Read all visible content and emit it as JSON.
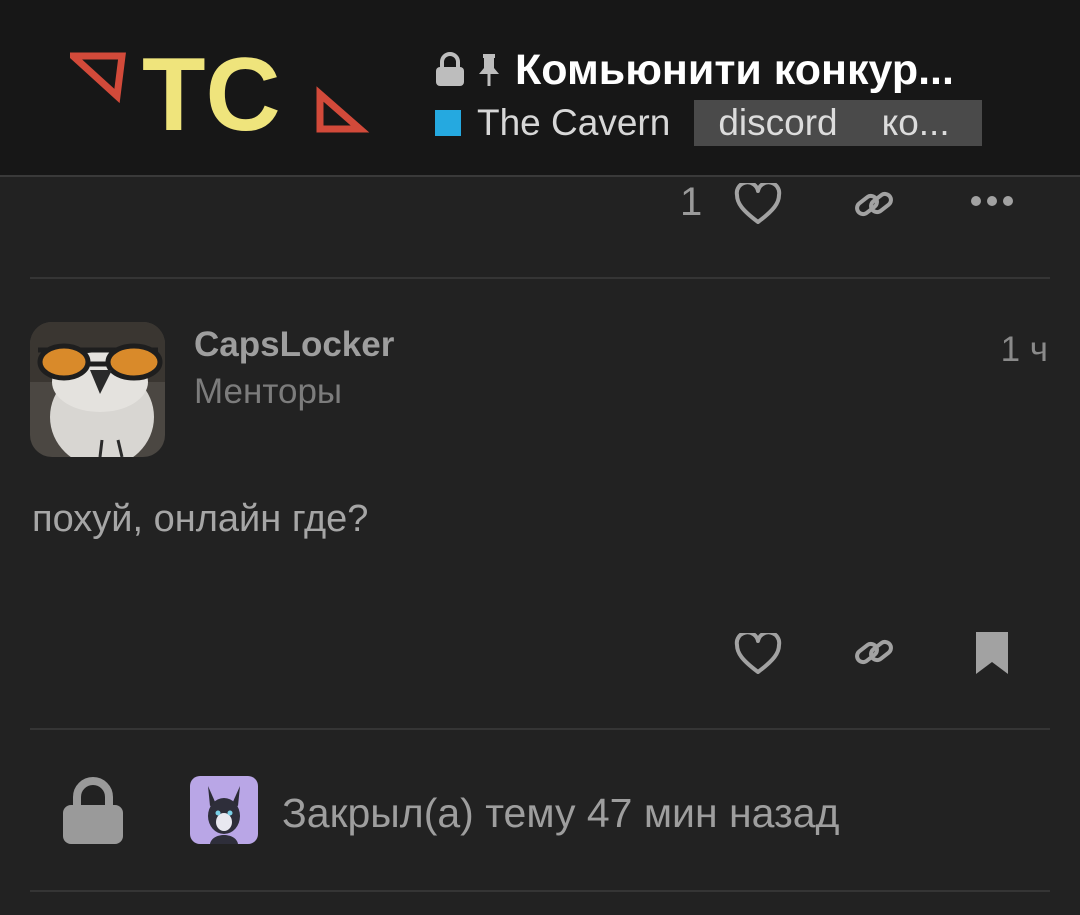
{
  "header": {
    "logo_text": "TC",
    "topic_title": "Комьюнити конкур...",
    "category": "The Cavern",
    "tags": [
      "discord",
      "ко..."
    ],
    "colors": {
      "logo_yellow": "#efe47c",
      "logo_red": "#d24a3a",
      "category": "#25a9e0",
      "background": "#171717"
    },
    "icons": [
      "lock-icon",
      "pin-icon"
    ]
  },
  "previous_post": {
    "like_count": "1",
    "icons": [
      "heart-icon",
      "link-icon",
      "more-icon"
    ]
  },
  "post": {
    "username": "CapsLocker",
    "user_group": "Менторы",
    "time": "1 ч",
    "body": "похуй, онлайн где?",
    "icons": [
      "heart-icon",
      "link-icon",
      "bookmark-icon"
    ]
  },
  "small_action": {
    "text": "Закрыл(а) тему 47 мин назад",
    "icons": [
      "lock-icon"
    ]
  }
}
